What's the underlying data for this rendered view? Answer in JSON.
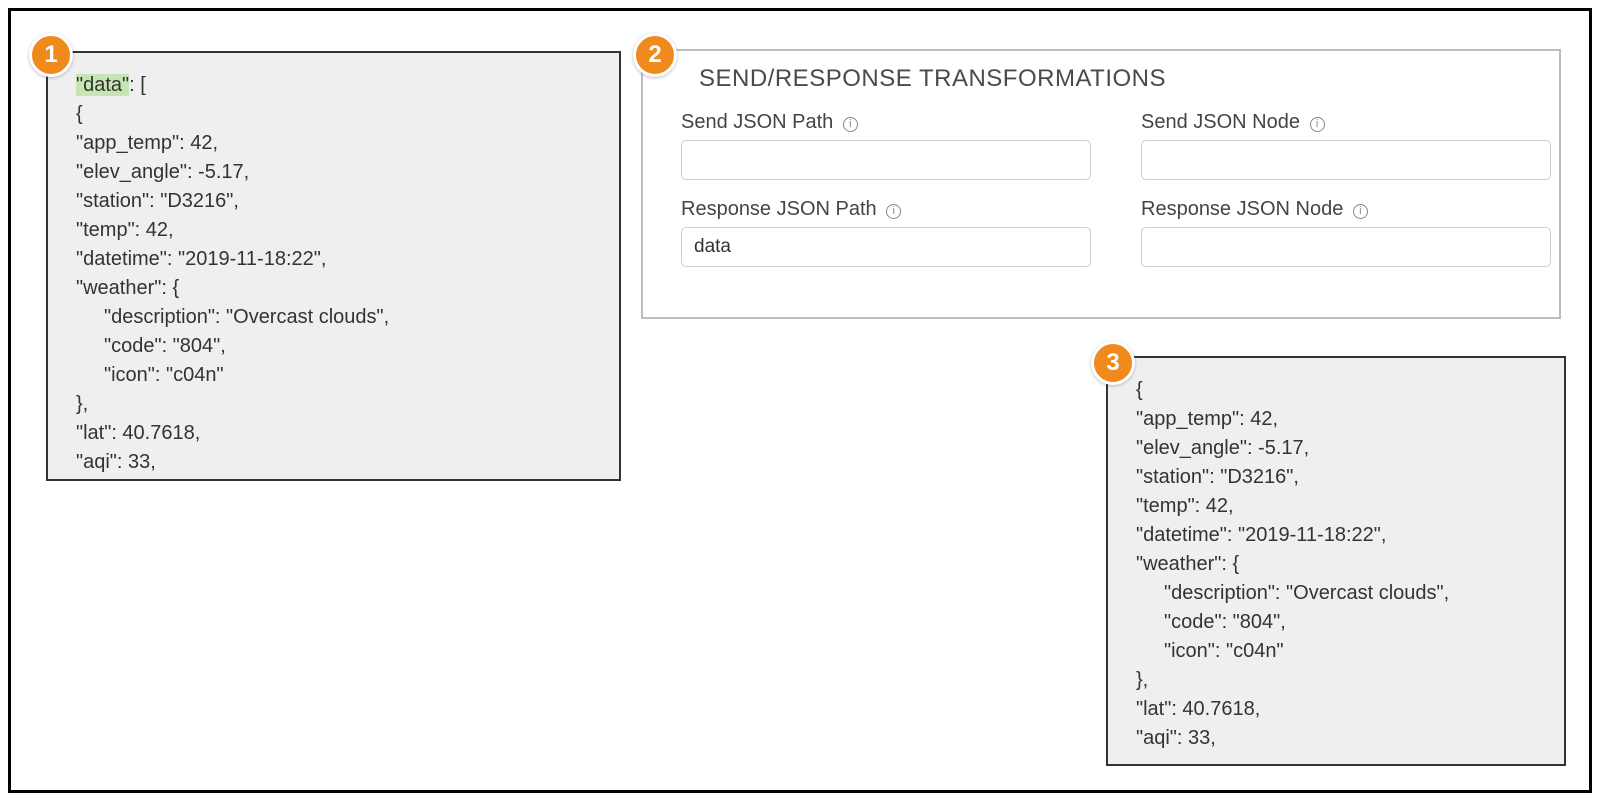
{
  "badges": {
    "b1": "1",
    "b2": "2",
    "b3": "3"
  },
  "codebox1": {
    "hl_key": "\"data\"",
    "hl_suffix": ": [",
    "lines": [
      "{",
      "\"app_temp\": 42,",
      "\"elev_angle\": -5.17,",
      "\"station\": \"D3216\",",
      "\"temp\": 42,",
      "\"datetime\": \"2019-11-18:22\",",
      "\"weather\": {",
      "   \"description\": \"Overcast clouds\",",
      "   \"code\": \"804\",",
      "   \"icon\": \"c04n\"",
      "},",
      "\"lat\": 40.7618,",
      "\"aqi\": 33,"
    ]
  },
  "codebox3": {
    "lines": [
      "{",
      "\"app_temp\": 42,",
      "\"elev_angle\": -5.17,",
      "\"station\": \"D3216\",",
      "\"temp\": 42,",
      "\"datetime\": \"2019-11-18:22\",",
      "\"weather\": {",
      "   \"description\": \"Overcast clouds\",",
      "   \"code\": \"804\",",
      "   \"icon\": \"c04n\"",
      "},",
      "\"lat\": 40.7618,",
      "\"aqi\": 33,"
    ]
  },
  "form": {
    "title": "SEND/RESPONSE TRANSFORMATIONS",
    "info_glyph": "i",
    "send_json_path": {
      "label": "Send JSON Path",
      "value": ""
    },
    "send_json_node": {
      "label": "Send JSON Node",
      "value": ""
    },
    "response_json_path": {
      "label": "Response JSON Path",
      "value": "data"
    },
    "response_json_node": {
      "label": "Response JSON Node",
      "value": ""
    }
  }
}
